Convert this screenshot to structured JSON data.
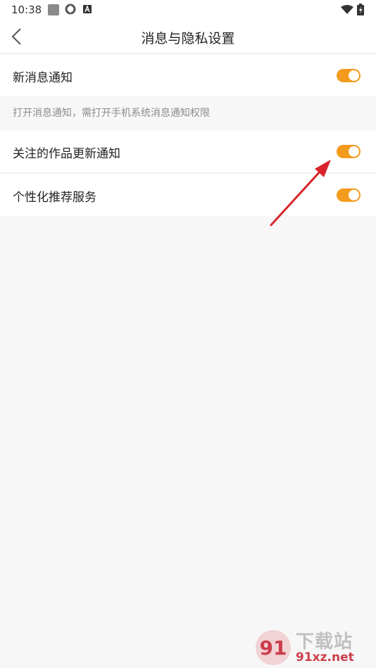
{
  "status_bar": {
    "time": "10:38",
    "icons": [
      "square-notification-icon",
      "ring-icon",
      "a-letter-icon",
      "wifi-icon",
      "battery-charging-icon"
    ]
  },
  "header": {
    "back_icon": "chevron-left-icon",
    "title": "消息与隐私设置"
  },
  "settings": {
    "new_message": {
      "label": "新消息通知",
      "on": true
    },
    "hint": "打开消息通知，需打开手机系统消息通知权限",
    "follow_updates": {
      "label": "关注的作品更新通知",
      "on": true
    },
    "personalized": {
      "label": "个性化推荐服务",
      "on": true
    }
  },
  "colors": {
    "toggle_on": "#f39b1d",
    "annotation_arrow": "#d8242a"
  },
  "watermark": {
    "logo_text": "91",
    "title": "下载站",
    "url": "91xz.net"
  }
}
